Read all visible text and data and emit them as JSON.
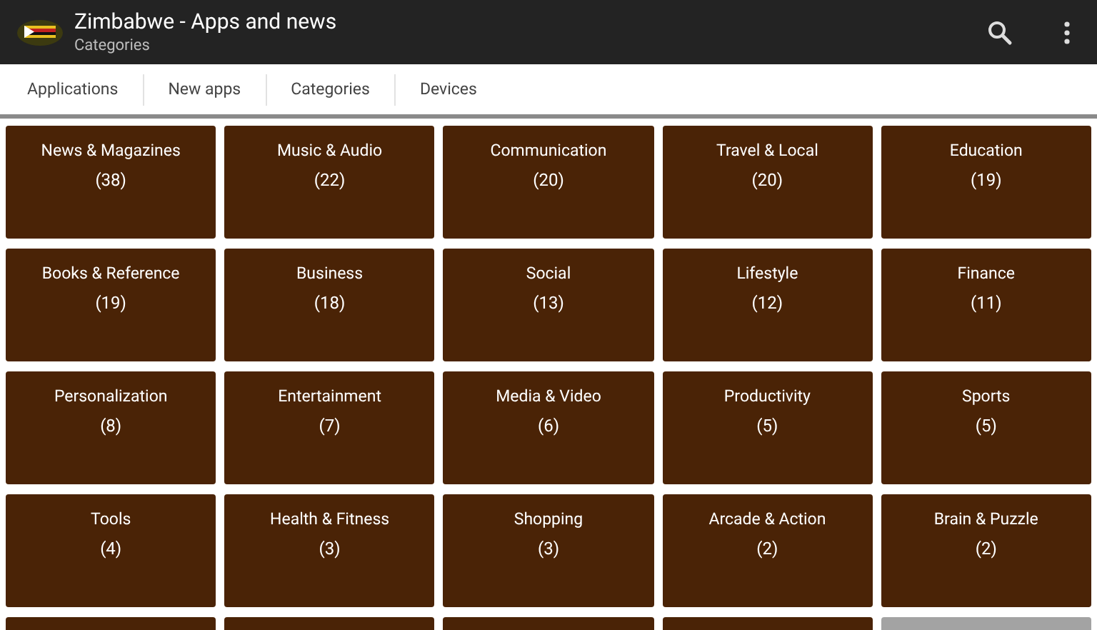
{
  "app_bar": {
    "title": "Zimbabwe - Apps and news",
    "subtitle": "Categories"
  },
  "tabs": [
    {
      "label": "Applications"
    },
    {
      "label": "New apps"
    },
    {
      "label": "Categories"
    },
    {
      "label": "Devices"
    }
  ],
  "categories": [
    {
      "name": "News & Magazines",
      "count": "(38)"
    },
    {
      "name": "Music & Audio",
      "count": "(22)"
    },
    {
      "name": "Communication",
      "count": "(20)"
    },
    {
      "name": "Travel & Local",
      "count": "(20)"
    },
    {
      "name": "Education",
      "count": "(19)"
    },
    {
      "name": "Books & Reference",
      "count": "(19)"
    },
    {
      "name": "Business",
      "count": "(18)"
    },
    {
      "name": "Social",
      "count": "(13)"
    },
    {
      "name": "Lifestyle",
      "count": "(12)"
    },
    {
      "name": "Finance",
      "count": "(11)"
    },
    {
      "name": "Personalization",
      "count": "(8)"
    },
    {
      "name": "Entertainment",
      "count": "(7)"
    },
    {
      "name": "Media & Video",
      "count": "(6)"
    },
    {
      "name": "Productivity",
      "count": "(5)"
    },
    {
      "name": "Sports",
      "count": "(5)"
    },
    {
      "name": "Tools",
      "count": "(4)"
    },
    {
      "name": "Health & Fitness",
      "count": "(3)"
    },
    {
      "name": "Shopping",
      "count": "(3)"
    },
    {
      "name": "Arcade & Action",
      "count": "(2)"
    },
    {
      "name": "Brain & Puzzle",
      "count": "(2)"
    }
  ],
  "partial_row": [
    {
      "kind": "tile"
    },
    {
      "kind": "tile"
    },
    {
      "kind": "tile"
    },
    {
      "kind": "tile"
    },
    {
      "kind": "loading"
    }
  ]
}
